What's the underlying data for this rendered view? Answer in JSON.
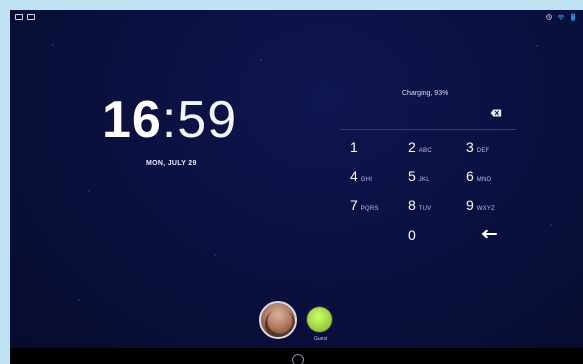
{
  "status_bar": {
    "left_icons": [
      "screenshot-icon",
      "picture-icon"
    ],
    "right_icons": [
      "alarm-icon",
      "wifi-icon",
      "battery-icon"
    ]
  },
  "lockscreen": {
    "time": {
      "hours": "16",
      "minutes": ":59"
    },
    "date": "MON, JULY 29",
    "charging": "Charging, 93%",
    "keypad": [
      {
        "digit": "1",
        "letters": ""
      },
      {
        "digit": "2",
        "letters": "ABC"
      },
      {
        "digit": "3",
        "letters": "DEF"
      },
      {
        "digit": "4",
        "letters": "GHI"
      },
      {
        "digit": "5",
        "letters": "JKL"
      },
      {
        "digit": "6",
        "letters": "MNO"
      },
      {
        "digit": "7",
        "letters": "PQRS"
      },
      {
        "digit": "8",
        "letters": "TUV"
      },
      {
        "digit": "9",
        "letters": "WXYZ"
      },
      {
        "digit": "0",
        "letters": ""
      }
    ],
    "users": {
      "guest_label": "Guest"
    }
  },
  "colors": {
    "accent": "#9fd63a",
    "background": "#0a1040"
  }
}
